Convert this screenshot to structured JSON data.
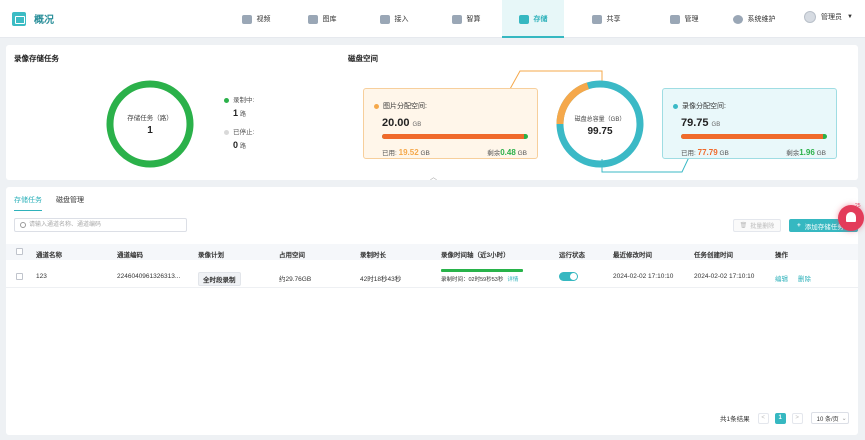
{
  "header": {
    "logo_text": "概况",
    "nav": [
      {
        "label": "视频",
        "icon": "monitor-icon"
      },
      {
        "label": "图库",
        "icon": "image-icon"
      },
      {
        "label": "接入",
        "icon": "cloud-icon"
      },
      {
        "label": "智算",
        "icon": "chip-icon"
      },
      {
        "label": "存储",
        "icon": "storage-icon",
        "active": true
      },
      {
        "label": "共享",
        "icon": "share-icon"
      },
      {
        "label": "管理",
        "icon": "manage-icon"
      },
      {
        "label": "系统维护",
        "icon": "gear-icon"
      }
    ],
    "user": "管理员"
  },
  "recording": {
    "title": "录像存储任务",
    "ring_label": "存储任务（路）",
    "ring_value": "1",
    "recording_label": "录制中:",
    "recording_value": "1",
    "stopped_label": "已停止:",
    "stopped_value": "0",
    "unit": "路",
    "colors": {
      "recording": "#2bb14a",
      "stopped": "#d9d9d9"
    }
  },
  "disk": {
    "title": "磁盘空间",
    "total_label": "磁盘总容量（GB）",
    "total_value": "99.75",
    "unit": "GB",
    "used_label": "已用:",
    "remain_label": "剩余",
    "image": {
      "label": "图片分配空间:",
      "value": "20.00",
      "used": "19.52",
      "remain": "0.48",
      "used_fraction": 0.976,
      "color": "#f5a84b"
    },
    "video": {
      "label": "录像分配空间:",
      "value": "79.75",
      "used": "77.79",
      "remain": "1.96",
      "used_fraction": 0.975,
      "color": "#3bb9c6"
    }
  },
  "tabs": [
    "存储任务",
    "磁盘管理"
  ],
  "search": {
    "placeholder": "请输入通道名称、通道编码"
  },
  "buttons": {
    "batch_delete": "批量删除",
    "add_task": "添加存储任务"
  },
  "table": {
    "headers": [
      "通道名称",
      "通道编码",
      "录像计划",
      "占用空间",
      "录制时长",
      "录像时间轴（近3小时）",
      "运行状态",
      "最近修改时间",
      "任务创建时间",
      "操作"
    ],
    "rows": [
      {
        "name": "123",
        "code": "2246040961326313...",
        "plan": "全时段录制",
        "space": "约29.76GB",
        "duration": "42时18秒43秒",
        "timeline_text": "录制时间：02时59秒53秒",
        "timeline_link": "详情",
        "status_on": true,
        "modified": "2024-02-02 17:10:10",
        "created": "2024-02-02 17:10:10",
        "edit": "编辑",
        "delete": "删除"
      }
    ]
  },
  "pagination": {
    "total": "共1条结果",
    "prev": "<",
    "page": "1",
    "next": ">",
    "page_size": "10 条/页"
  },
  "notify_badge": "25"
}
